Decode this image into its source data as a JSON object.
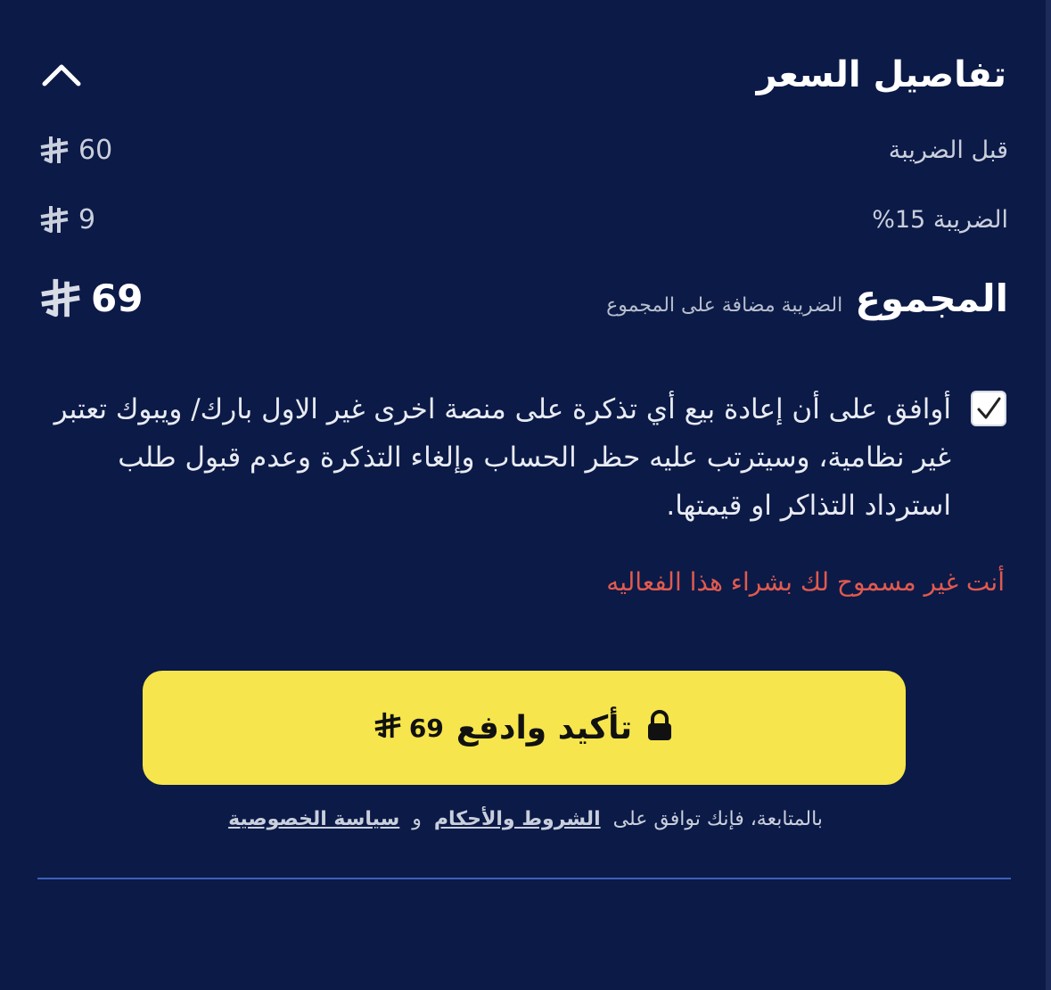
{
  "price_details": {
    "title": "تفاصيل السعر",
    "collapse_icon": "chevron-up-icon",
    "before_tax_label": "قبل الضريبة",
    "before_tax_value": "60",
    "tax_label": "الضريبة 15%",
    "tax_value": "9",
    "total_label": "المجموع",
    "total_note": "الضريبة مضافة على المجموع",
    "total_value": "69",
    "currency_icon": "riyal-icon"
  },
  "agreement": {
    "checked": true,
    "text": "أوافق على أن إعادة بيع أي تذكرة على منصة اخرى غير الاول بارك/ ويبوك تعتبر غير نظامية، وسيترتب عليه حظر الحساب وإلغاء التذكرة وعدم قبول طلب استرداد التذاكر او قيمتها."
  },
  "error_message": "أنت غير مسموح لك بشراء هذا الفعاليه",
  "pay_button": {
    "label": "تأكيد وادفع",
    "amount": "69",
    "icon": "lock-icon",
    "color": "#f6e54c"
  },
  "terms": {
    "prefix": "بالمتابعة، فإنك توافق على",
    "terms_link": "الشروط والأحكام",
    "conjunction": "و",
    "privacy_link": "سياسة الخصوصية"
  },
  "colors": {
    "background": "#0c1a47",
    "error": "#e05a4f",
    "divider": "#3d5fb8"
  }
}
